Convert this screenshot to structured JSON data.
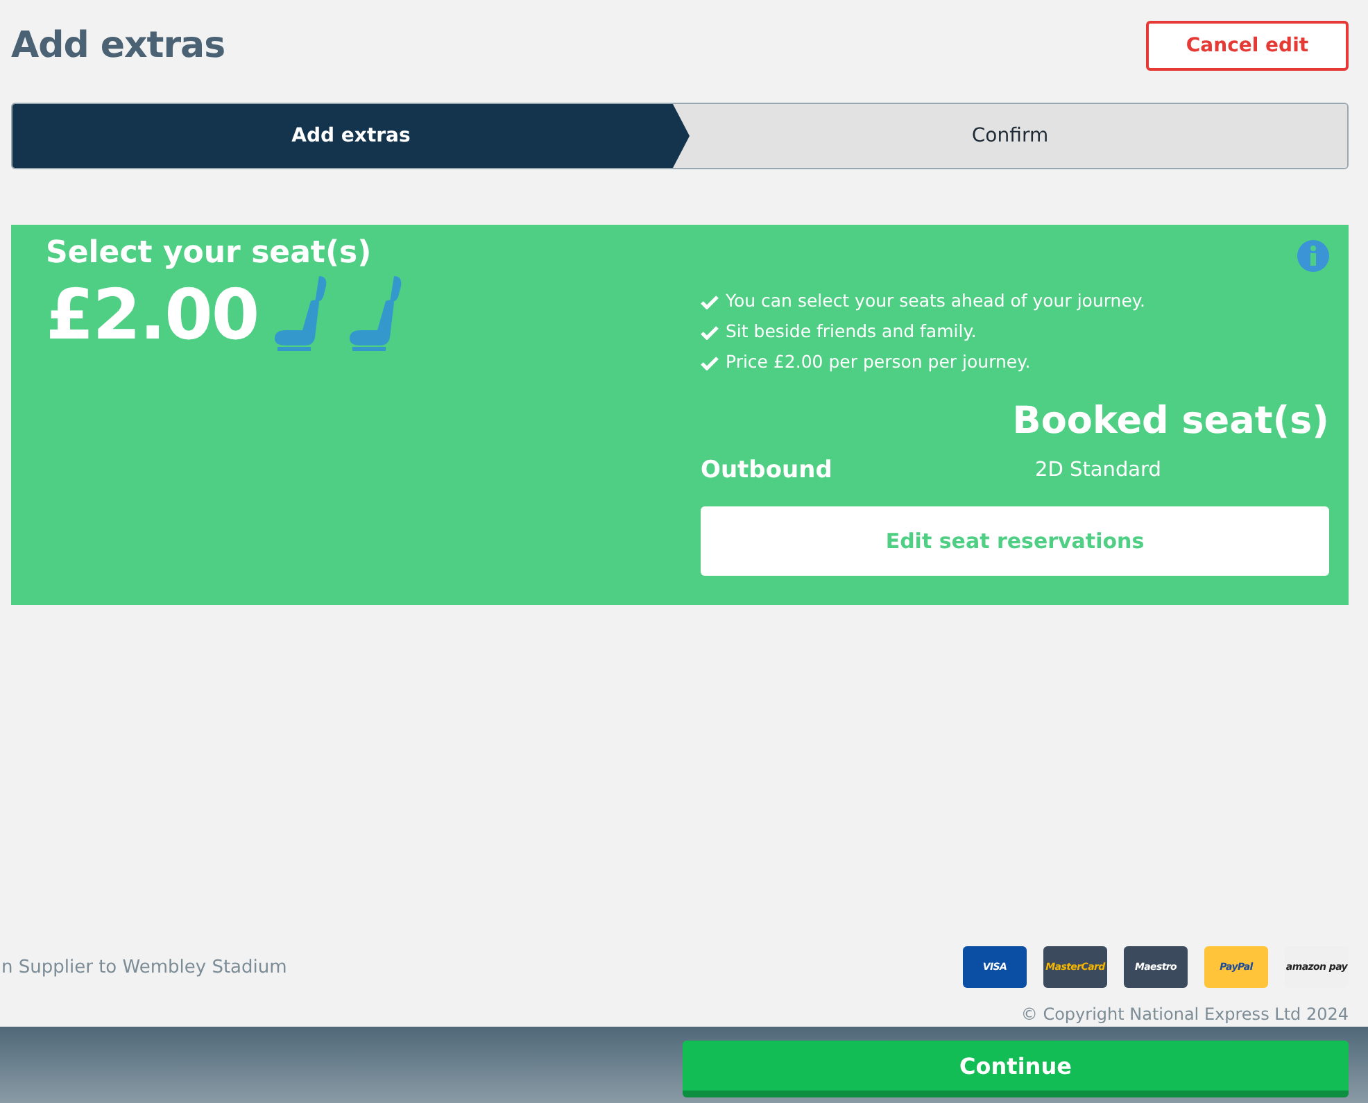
{
  "page_title": "Add extras",
  "cancel_button": "Cancel edit",
  "steps": [
    {
      "label": "Add extras",
      "selected": true
    },
    {
      "label": "Confirm",
      "selected": false
    }
  ],
  "seat_card": {
    "title": "Select your seat(s)",
    "price": "£2.00",
    "benefits": [
      "You can select your seats ahead of your journey.",
      "Sit beside friends and family.",
      "Price £2.00 per person per journey."
    ],
    "booked_heading": "Booked seat(s)",
    "bookings": [
      {
        "direction": "Outbound",
        "seat": "2D Standard"
      }
    ],
    "edit_button": "Edit seat reservations"
  },
  "footer": {
    "partner_text": "n Supplier to Wembley Stadium",
    "payment_methods": [
      {
        "kind": "visa",
        "label": "VISA"
      },
      {
        "kind": "mastercard",
        "label": "MasterCard"
      },
      {
        "kind": "maestro",
        "label": "Maestro"
      },
      {
        "kind": "paypal",
        "label": "PayPal"
      },
      {
        "kind": "amazon",
        "label": "amazon pay"
      }
    ],
    "copyright": "© Copyright National Express Ltd 2024"
  },
  "continue_button": "Continue"
}
